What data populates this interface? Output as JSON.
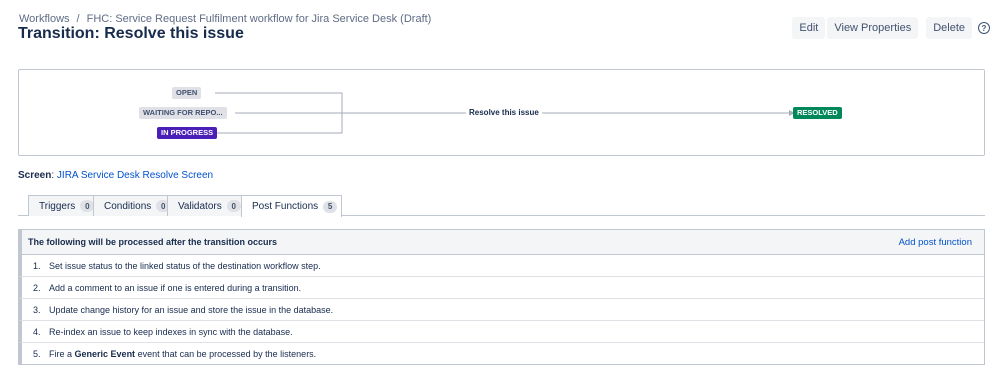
{
  "breadcrumb": {
    "root": "Workflows",
    "separator": "/",
    "workflow": "FHC: Service Request Fulfilment workflow for Jira Service Desk (Draft)"
  },
  "title": "Transition: Resolve this issue",
  "actions": {
    "edit": "Edit",
    "view_properties": "View Properties",
    "delete": "Delete",
    "help": "?"
  },
  "diagram": {
    "from_statuses": [
      {
        "label": "OPEN",
        "color": "#dfe1e6"
      },
      {
        "label": "WAITING FOR REPO...",
        "color": "#dfe1e6"
      },
      {
        "label": "IN PROGRESS",
        "color": "#4a1fb8"
      }
    ],
    "transition_label": "Resolve this issue",
    "to_status": {
      "label": "RESOLVED",
      "color": "#00875a"
    }
  },
  "screen": {
    "label": "Screen",
    "value": "JIRA Service Desk Resolve Screen"
  },
  "tabs": [
    {
      "label": "Triggers",
      "count": "0"
    },
    {
      "label": "Conditions",
      "count": "0"
    },
    {
      "label": "Validators",
      "count": "0"
    },
    {
      "label": "Post Functions",
      "count": "5",
      "active": true
    }
  ],
  "post_functions": {
    "header": "The following will be processed after the transition occurs",
    "add_link": "Add post function",
    "items": [
      {
        "num": "1.",
        "text": "Set issue status to the linked status of the destination workflow step."
      },
      {
        "num": "2.",
        "text": "Add a comment to an issue if one is entered during a transition."
      },
      {
        "num": "3.",
        "text": "Update change history for an issue and store the issue in the database."
      },
      {
        "num": "4.",
        "text": "Re-index an issue to keep indexes in sync with the database."
      },
      {
        "num": "5.",
        "pre": "Fire a",
        "bold": "Generic Event",
        "post": "event that can be processed by the listeners."
      }
    ]
  }
}
